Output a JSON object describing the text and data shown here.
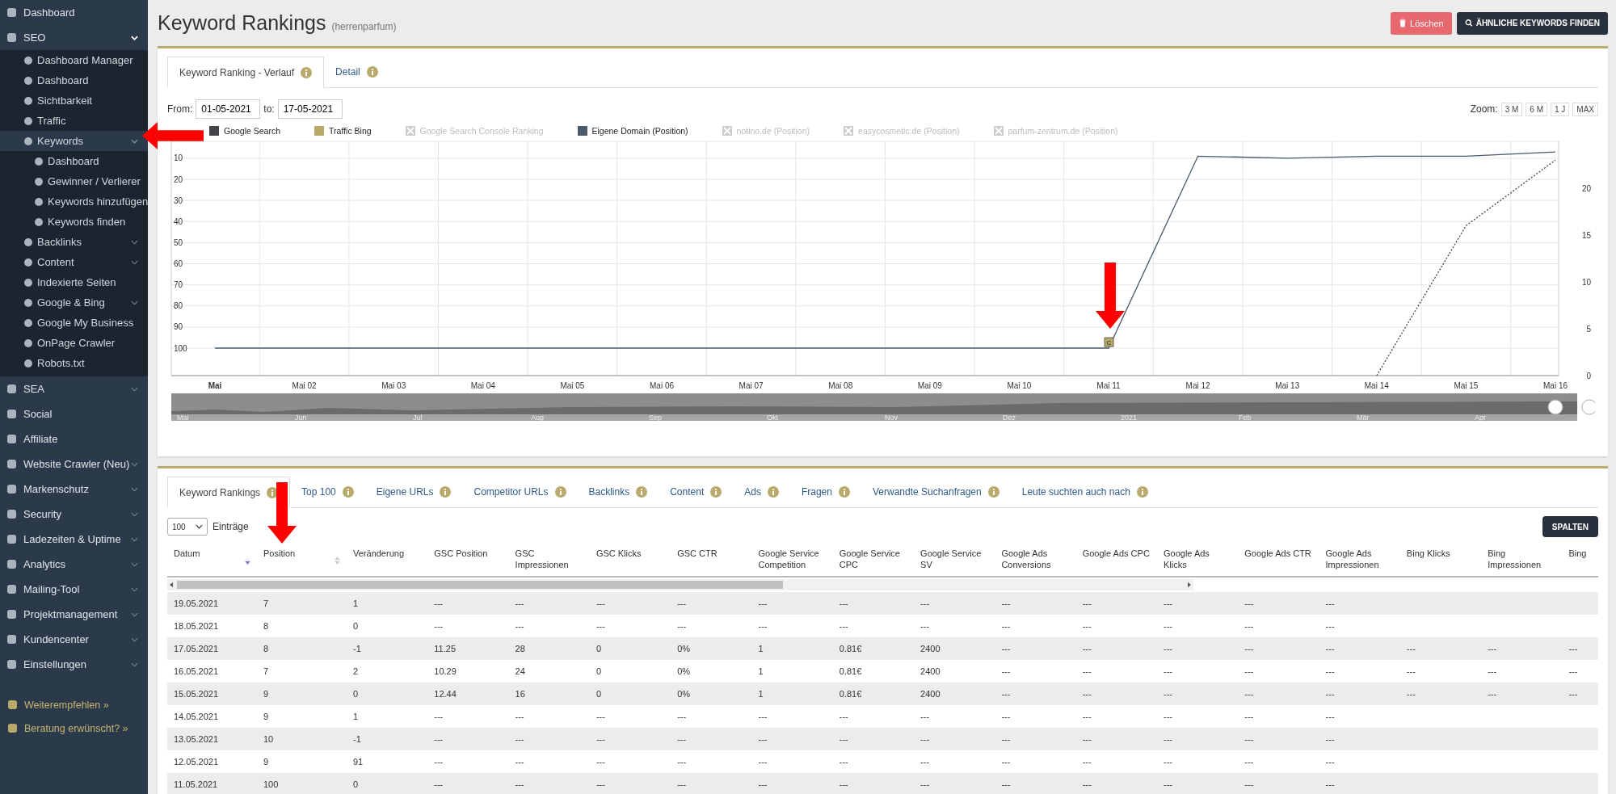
{
  "sidebar": {
    "items": [
      {
        "label": "Dashboard",
        "selected": false
      },
      {
        "label": "SEO",
        "selected": false,
        "expanded": true,
        "children": [
          {
            "label": "Dashboard Manager",
            "selected": false
          },
          {
            "label": "Dashboard",
            "selected": false
          },
          {
            "label": "Sichtbarkeit",
            "selected": false
          },
          {
            "label": "Traffic",
            "selected": false
          },
          {
            "label": "Keywords",
            "selected": true,
            "expanded": true,
            "children": [
              {
                "label": "Dashboard",
                "selected": false
              },
              {
                "label": "Gewinner / Verlierer",
                "selected": false
              },
              {
                "label": "Keywords hinzufügen",
                "selected": false
              },
              {
                "label": "Keywords finden",
                "selected": false
              }
            ]
          },
          {
            "label": "Backlinks",
            "selected": false,
            "expanded": false
          },
          {
            "label": "Content",
            "selected": false,
            "expanded": false
          },
          {
            "label": "Indexierte Seiten",
            "selected": false
          },
          {
            "label": "Google & Bing",
            "selected": false,
            "expanded": false
          },
          {
            "label": "Google My Business",
            "selected": false
          },
          {
            "label": "OnPage Crawler",
            "selected": false
          },
          {
            "label": "Robots.txt",
            "selected": false
          }
        ]
      },
      {
        "label": "SEA",
        "selected": false,
        "expanded": false
      },
      {
        "label": "Social",
        "selected": false
      },
      {
        "label": "Affiliate",
        "selected": false
      },
      {
        "label": "Website Crawler (Neu)",
        "selected": false,
        "expanded": false
      },
      {
        "label": "Markenschutz",
        "selected": false,
        "expanded": false
      },
      {
        "label": "Security",
        "selected": false,
        "expanded": false
      },
      {
        "label": "Ladezeiten & Uptime",
        "selected": false,
        "expanded": false
      },
      {
        "label": "Analytics",
        "selected": false,
        "expanded": false
      },
      {
        "label": "Mailing-Tool",
        "selected": false,
        "expanded": false
      },
      {
        "label": "Projektmanagement",
        "selected": false,
        "expanded": false
      },
      {
        "label": "Kundencenter",
        "selected": false,
        "expanded": false
      },
      {
        "label": "Einstellungen",
        "selected": false,
        "expanded": false
      }
    ],
    "links": [
      "Weiterempfehlen »",
      "Beratung erwünscht? »"
    ]
  },
  "header": {
    "title": "Keyword Rankings",
    "subtitle": "(herrenparfum)",
    "buttons": [
      {
        "label": "Löschen",
        "kind": "danger"
      },
      {
        "label": "ÄHNLICHE KEYWORDS FINDEN",
        "kind": "primary"
      }
    ]
  },
  "chart_panel": {
    "tabs": [
      {
        "label": "Keyword Ranking - Verlauf",
        "selected": true
      },
      {
        "label": "Detail",
        "selected": false
      }
    ],
    "from_label": "From:",
    "from": "01-05-2021",
    "to_label": "to:",
    "to": "17-05-2021",
    "zoom_label": "Zoom:",
    "zoom_buttons": [
      "3 M",
      "6 M",
      "1 J",
      "MAX"
    ],
    "chart_data": {
      "type": "line",
      "categories": [
        "Mai",
        "Mai 02",
        "Mai 03",
        "Mai 04",
        "Mai 05",
        "Mai 06",
        "Mai 07",
        "Mai 08",
        "Mai 09",
        "Mai 10",
        "Mai 11",
        "Mai 12",
        "Mai 13",
        "Mai 14",
        "Mai 15",
        "Mai 16"
      ],
      "series": [
        {
          "name": "Google Search",
          "color": "#434348",
          "axis": "y2",
          "line_style": "dotted",
          "values": [
            null,
            null,
            null,
            null,
            null,
            null,
            null,
            null,
            null,
            null,
            null,
            null,
            null,
            0,
            16,
            23
          ]
        },
        {
          "name": "Eigene Domain (Position)",
          "color": "#4a5a6a",
          "values": [
            100,
            100,
            100,
            100,
            100,
            100,
            100,
            100,
            100,
            100,
            100,
            9,
            10,
            9,
            9,
            7
          ]
        }
      ],
      "ylim": [
        113,
        2
      ],
      "yticks": [
        10,
        20,
        30,
        40,
        50,
        60,
        70,
        80,
        90,
        100
      ],
      "y2lim": [
        0,
        25
      ],
      "y2ticks": [
        0,
        5,
        10,
        15,
        20
      ],
      "grid": true,
      "annotations": [
        {
          "x": "Mai 11",
          "text": "C"
        }
      ]
    },
    "legend": [
      {
        "kind": "series",
        "enabled": true
      },
      {
        "kind": "plain",
        "label": "Traffic Bing",
        "color": "#b9a96b",
        "enabled": true
      },
      {
        "kind": "plain",
        "label": "Google Search Console Ranking",
        "enabled": false
      },
      {
        "kind": "series",
        "enabled": true
      },
      {
        "kind": "plain",
        "label": "notino.de (Position)",
        "enabled": false
      },
      {
        "kind": "plain",
        "label": "easycosmetic.de (Position)",
        "enabled": false
      },
      {
        "kind": "plain",
        "label": "parfum-zentrum.de (Position)",
        "enabled": false
      }
    ],
    "navigator_labels": [
      "Mai",
      "Jun",
      "Jul",
      "Aug",
      "Sep",
      "Okt",
      "Nov",
      "Dez",
      "2021",
      "Feb",
      "Mär",
      "Apr"
    ]
  },
  "table_panel": {
    "tabs": [
      {
        "label": "Keyword Rankings",
        "selected": true
      },
      {
        "label": "Top 100",
        "selected": false
      },
      {
        "label": "Eigene URLs",
        "selected": false
      },
      {
        "label": "Competitor URLs",
        "selected": false
      },
      {
        "label": "Backlinks",
        "selected": false
      },
      {
        "label": "Content",
        "selected": false
      },
      {
        "label": "Ads",
        "selected": false
      },
      {
        "label": "Fragen",
        "selected": false
      },
      {
        "label": "Verwandte Suchanfragen",
        "selected": false
      },
      {
        "label": "Leute suchten auch nach",
        "selected": false
      }
    ],
    "page_size": "100",
    "entries_label": "Einträge",
    "columns_button": "SPALTEN",
    "columns": [
      {
        "label": "Datum",
        "sorted": true,
        "sortable": true
      },
      {
        "label": "Position",
        "sorted": false,
        "sortable": true
      },
      {
        "label": "Veränderung",
        "sorted": false,
        "sortable": false
      },
      {
        "label": "GSC Position",
        "sorted": false,
        "sortable": false
      },
      {
        "label": "GSC Impressionen",
        "sorted": false,
        "sortable": false
      },
      {
        "label": "GSC Klicks",
        "sorted": false,
        "sortable": false
      },
      {
        "label": "GSC CTR",
        "sorted": false,
        "sortable": false
      },
      {
        "label": "Google Service Competition",
        "sorted": false,
        "sortable": false
      },
      {
        "label": "Google Service CPC",
        "sorted": false,
        "sortable": false
      },
      {
        "label": "Google Service SV",
        "sorted": false,
        "sortable": false
      },
      {
        "label": "Google Ads Conversions",
        "sorted": false,
        "sortable": false
      },
      {
        "label": "Google Ads CPC",
        "sorted": false,
        "sortable": false
      },
      {
        "label": "Google Ads Klicks",
        "sorted": false,
        "sortable": false
      },
      {
        "label": "Google Ads CTR",
        "sorted": false,
        "sortable": false
      },
      {
        "label": "Google Ads Impressionen",
        "sorted": false,
        "sortable": false
      },
      {
        "label": "Bing Klicks",
        "sorted": false,
        "sortable": false
      },
      {
        "label": "Bing Impressionen",
        "sorted": false,
        "sortable": false
      },
      {
        "label": "Bing"
      }
    ],
    "rows": [
      [
        "19.05.2021",
        "7",
        "1",
        "---",
        "---",
        "---",
        "---",
        "---",
        "---",
        "---",
        "---",
        "---",
        "---",
        "---",
        "---"
      ],
      [
        "18.05.2021",
        "8",
        "0",
        "---",
        "---",
        "---",
        "---",
        "---",
        "---",
        "---",
        "---",
        "---",
        "---",
        "---",
        "---"
      ],
      [
        "17.05.2021",
        "8",
        "-1",
        "11.25",
        "28",
        "0",
        "0%",
        "1",
        "0.81€",
        "2400",
        "---",
        "---",
        "---",
        "---",
        "---",
        "---",
        "---",
        "---"
      ],
      [
        "16.05.2021",
        "7",
        "2",
        "10.29",
        "24",
        "0",
        "0%",
        "1",
        "0.81€",
        "2400",
        "---",
        "---",
        "---",
        "---",
        "---",
        "---",
        "---",
        "---"
      ],
      [
        "15.05.2021",
        "9",
        "0",
        "12.44",
        "16",
        "0",
        "0%",
        "1",
        "0.81€",
        "2400",
        "---",
        "---",
        "---",
        "---",
        "---",
        "---",
        "---",
        "---"
      ],
      [
        "14.05.2021",
        "9",
        "1",
        "---",
        "---",
        "---",
        "---",
        "---",
        "---",
        "---",
        "---",
        "---",
        "---",
        "---",
        "---"
      ],
      [
        "13.05.2021",
        "10",
        "-1",
        "---",
        "---",
        "---",
        "---",
        "---",
        "---",
        "---",
        "---",
        "---",
        "---",
        "---",
        "---"
      ],
      [
        "12.05.2021",
        "9",
        "91",
        "---",
        "---",
        "---",
        "---",
        "---",
        "---",
        "---",
        "---",
        "---",
        "---",
        "---",
        "---"
      ],
      [
        "11.05.2021",
        "100",
        "0",
        "---",
        "---",
        "---",
        "---",
        "---",
        "---",
        "---",
        "---",
        "---",
        "---",
        "---",
        "---"
      ]
    ]
  }
}
